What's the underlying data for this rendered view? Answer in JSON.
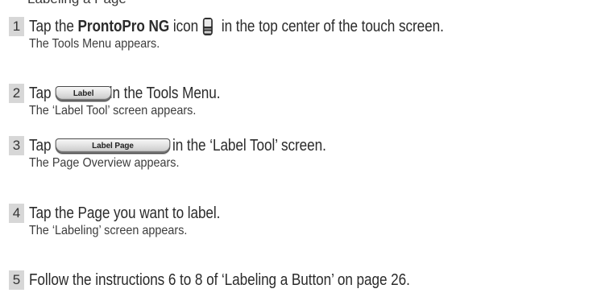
{
  "header_fragment": "Labeling a Page",
  "steps": [
    {
      "number": "1",
      "line_before_bold": "Tap the ",
      "bold": "ProntoPro NG",
      "line_after_bold": " icon",
      "icon": "remote-device-icon",
      "line_after_icon": " in the top center of the touch screen.",
      "result": "The Tools Menu appears."
    },
    {
      "number": "2",
      "line_before": "Tap",
      "button_label": "Label",
      "line_after": "in the Tools Menu.",
      "result": "The ‘Label Tool’ screen appears."
    },
    {
      "number": "3",
      "line_before": "Tap",
      "button_label": "Label Page",
      "line_after": "in the ‘Label Tool’ screen.",
      "result": "The Page Overview appears."
    },
    {
      "number": "4",
      "line": "Tap the Page you want to label.",
      "result": "The ‘Labeling’ screen appears."
    },
    {
      "number": "5",
      "line": "Follow the instructions 6 to 8 of ‘Labeling a Button’ on page 26."
    }
  ]
}
